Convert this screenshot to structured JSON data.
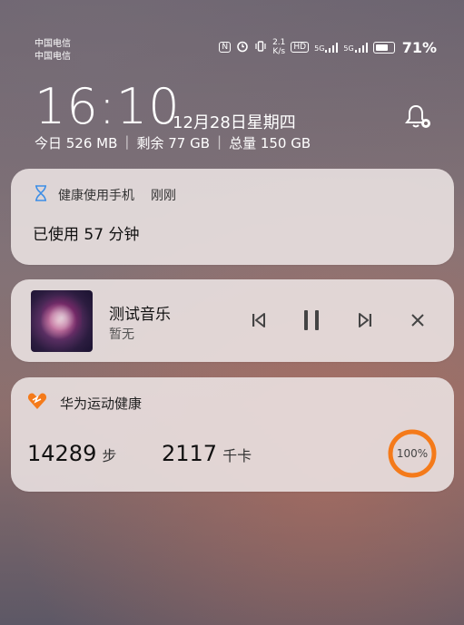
{
  "status_bar": {
    "carrier_1": "中国电信",
    "carrier_2": "中国电信",
    "net_speed_value": "2.1",
    "net_speed_unit": "K/s",
    "hd_badge": "HD",
    "signal_1": "5G",
    "signal_2": "5G",
    "battery_percent": "71%",
    "battery_level": 0.71
  },
  "lockscreen": {
    "time": "16:10",
    "date": "12月28日星期四",
    "storage": {
      "today": "今日 526 MB",
      "remaining": "剩余 77 GB",
      "total": "总量 150 GB"
    }
  },
  "notifications": {
    "health_usage": {
      "app_name": "健康使用手机",
      "time": "刚刚",
      "body": "已使用 57 分钟"
    },
    "music": {
      "title": "测试音乐",
      "artist": "暂无"
    },
    "fitness": {
      "app_name": "华为运动健康",
      "steps_value": "14289",
      "steps_unit": "步",
      "kcal_value": "2117",
      "kcal_unit": "千卡",
      "progress_label": "100%",
      "progress": 1.0
    }
  },
  "colors": {
    "fitness_accent": "#f47a1a",
    "hourglass": "#3d8ee6"
  }
}
